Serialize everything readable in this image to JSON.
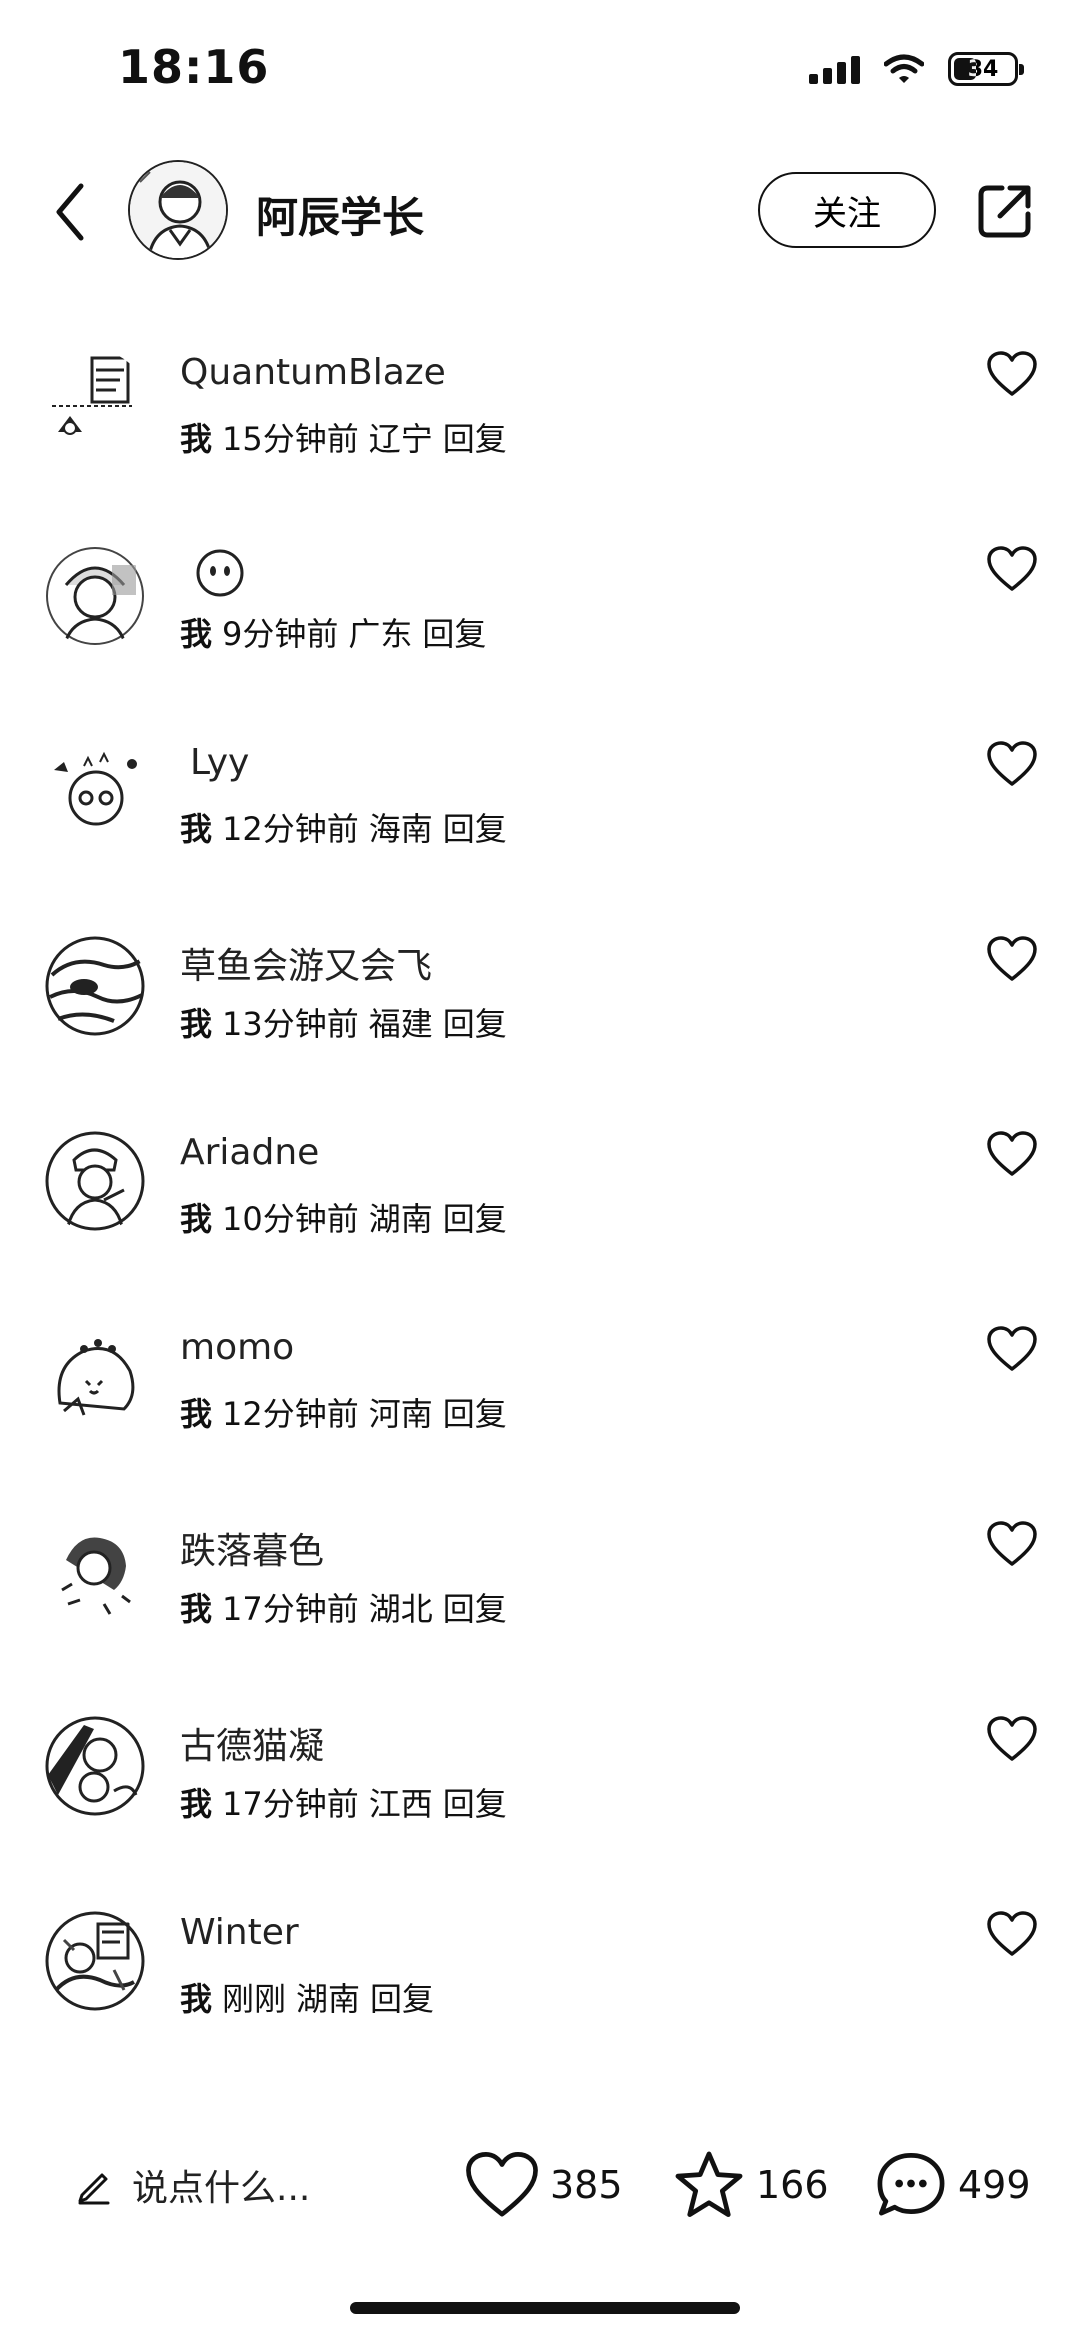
{
  "status_bar": {
    "time": "18:16",
    "battery": "34"
  },
  "header": {
    "author_name": "阿辰学长",
    "follow_label": "关注"
  },
  "comments": [
    {
      "name": "QuantumBlaze",
      "me": "我",
      "time": "15分钟前",
      "region": "辽宁",
      "reply": "回复"
    },
    {
      "name": "",
      "me": "我",
      "time": "9分钟前",
      "region": "广东",
      "reply": "回复"
    },
    {
      "name": "Lyy",
      "me": "我",
      "time": "12分钟前",
      "region": "海南",
      "reply": "回复"
    },
    {
      "name": "草鱼会游又会飞",
      "me": "我",
      "time": "13分钟前",
      "region": "福建",
      "reply": "回复"
    },
    {
      "name": "Ariadne",
      "me": "我",
      "time": "10分钟前",
      "region": "湖南",
      "reply": "回复"
    },
    {
      "name": "momo",
      "me": "我",
      "time": "12分钟前",
      "region": "河南",
      "reply": "回复"
    },
    {
      "name": "跌落暮色",
      "me": "我",
      "time": "17分钟前",
      "region": "湖北",
      "reply": "回复"
    },
    {
      "name": "古德猫凝",
      "me": "我",
      "time": "17分钟前",
      "region": "江西",
      "reply": "回复"
    },
    {
      "name": "Winter",
      "me": "我",
      "time": "刚刚",
      "region": "湖南",
      "reply": "回复"
    }
  ],
  "bottom_bar": {
    "input_placeholder": "说点什么...",
    "like_count": "385",
    "collect_count": "166",
    "comment_count": "499"
  },
  "icons": [
    "back-icon",
    "share-icon",
    "heart-icon",
    "star-icon",
    "chat-icon",
    "pencil-icon",
    "wifi-icon",
    "signal-icon",
    "battery-icon"
  ]
}
